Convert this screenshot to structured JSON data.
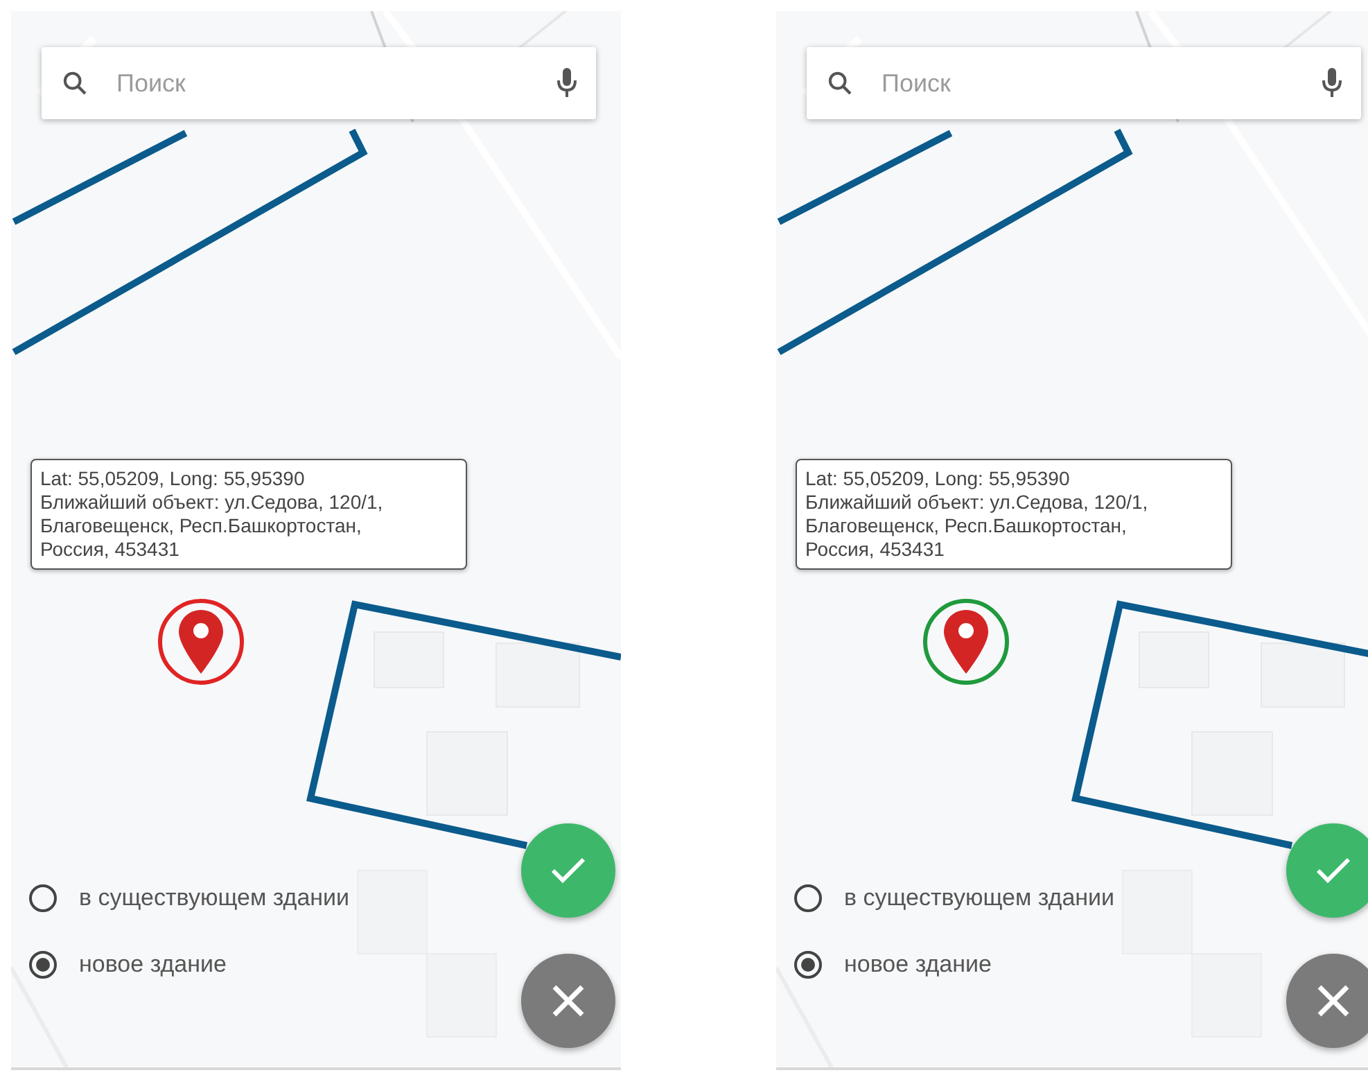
{
  "screens": [
    {
      "search": {
        "placeholder": "Поиск"
      },
      "info": [
        "Lat: 55,05209, Long: 55,95390",
        "Ближайший объект: ул.Седова, 120/1,",
        "Благовещенск, Респ.Башкортостан,",
        "Россия, 453431"
      ],
      "marker": {
        "color": "#e02424"
      },
      "options": [
        {
          "label": "в существующем здании",
          "selected": false
        },
        {
          "label": "новое здание",
          "selected": true
        }
      ]
    },
    {
      "search": {
        "placeholder": "Поиск"
      },
      "info": [
        "Lat: 55,05209, Long: 55,95390",
        "Ближайший объект: ул.Седова, 120/1,",
        "Благовещенск, Респ.Башкортостан,",
        "Россия, 453431"
      ],
      "marker": {
        "color": "#1f9a3c"
      },
      "options": [
        {
          "label": "в существующем здании",
          "selected": false
        },
        {
          "label": "новое здание",
          "selected": true
        }
      ]
    }
  ]
}
